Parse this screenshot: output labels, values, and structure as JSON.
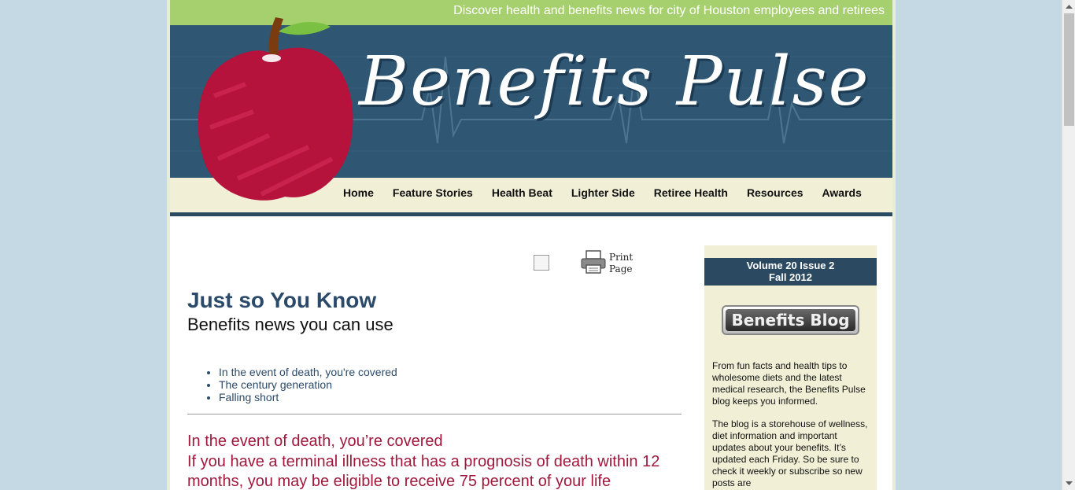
{
  "header": {
    "tagline": "Discover health and benefits news for city of Houston employees and retirees",
    "logo_text": "Benefits Pulse",
    "colors": {
      "topbar": "#a6cf6e",
      "banner": "#2f5672",
      "navbar": "#f1efd6",
      "apple": "#b5123c",
      "leaf": "#7ac143"
    }
  },
  "nav": {
    "items": [
      {
        "label": "Home"
      },
      {
        "label": "Feature Stories"
      },
      {
        "label": "Health Beat"
      },
      {
        "label": "Lighter Side"
      },
      {
        "label": "Retiree Health"
      },
      {
        "label": "Resources"
      },
      {
        "label": "Awards"
      }
    ]
  },
  "main": {
    "print_label": "Print Page",
    "title": "Just so You Know",
    "subtitle": "Benefits news you can use",
    "toc": [
      {
        "label": "In the event of death, you're covered"
      },
      {
        "label": "The century generation"
      },
      {
        "label": "Falling short"
      }
    ],
    "article": {
      "heading": "In the event of death, you’re covered",
      "body": "If you have a terminal illness that has a prognosis of death within 12 months, you may be eligible to receive 75 percent of your life"
    }
  },
  "sidebar": {
    "volume": "Volume 20 Issue 2",
    "season": "Fall 2012",
    "blog_button": "Benefits Blog",
    "para1": "From fun facts and health tips to wholesome diets and the latest medical research, the Benefits Pulse blog keeps you informed.",
    "para2": "The blog is a storehouse of wellness, diet information and important updates about your benefits. It’s updated each Friday. So be sure to check it weekly or subscribe so new posts are"
  }
}
